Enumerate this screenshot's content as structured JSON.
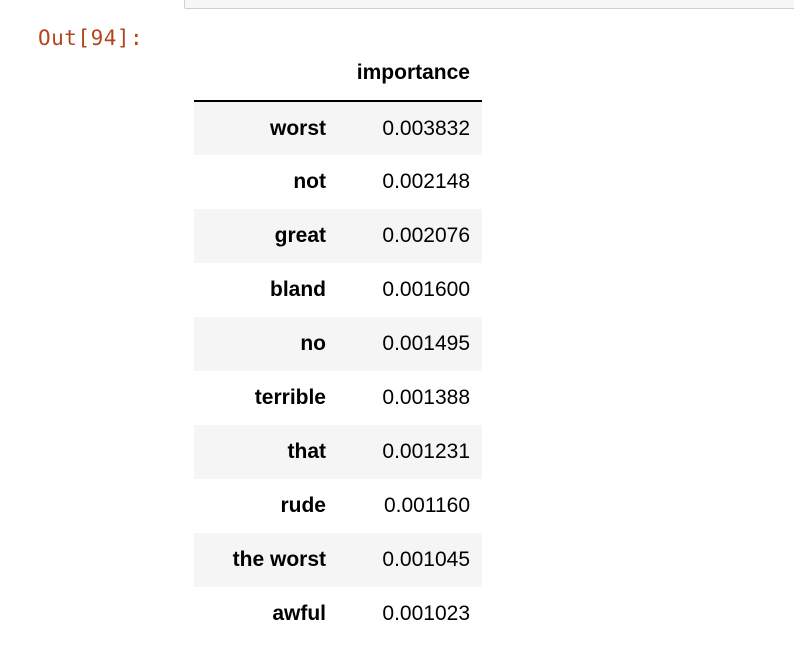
{
  "cell": {
    "out_prompt": "Out[94]:"
  },
  "dataframe": {
    "index_header": "",
    "columns": [
      "importance"
    ],
    "rows": [
      {
        "index": "worst",
        "importance": "0.003832"
      },
      {
        "index": "not",
        "importance": "0.002148"
      },
      {
        "index": "great",
        "importance": "0.002076"
      },
      {
        "index": "bland",
        "importance": "0.001600"
      },
      {
        "index": "no",
        "importance": "0.001495"
      },
      {
        "index": "terrible",
        "importance": "0.001388"
      },
      {
        "index": "that",
        "importance": "0.001231"
      },
      {
        "index": "rude",
        "importance": "0.001160"
      },
      {
        "index": "the worst",
        "importance": "0.001045"
      },
      {
        "index": "awful",
        "importance": "0.001023"
      }
    ]
  },
  "colors": {
    "prompt": "#b4461e",
    "row_stripe": "#f5f5f5",
    "text": "#000000"
  }
}
